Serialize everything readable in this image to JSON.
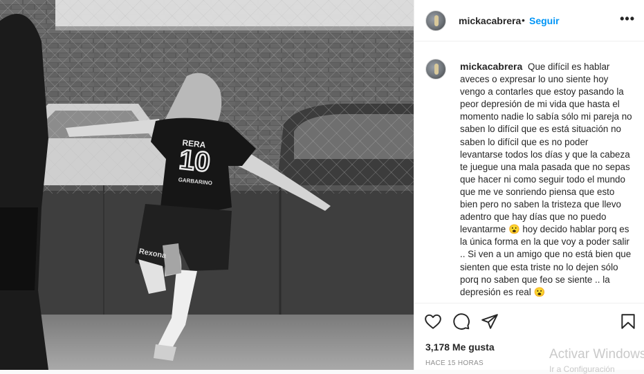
{
  "post": {
    "username": "mickacabrera",
    "separator": "•",
    "follow_label": "Seguir",
    "more_icon": "more-options-icon",
    "caption": "Que difícil es hablar aveces o expresar lo uno siente hoy vengo a contarles que estoy pasando la peor depresión de mi vida que hasta el momento nadie lo sabía sólo mi pareja no saben lo difícil que es está situación no saben lo difícil que es no poder levantarse todos los días y que la cabeza te juegue una mala pasada que no sepas que hacer ni como seguir todo el mundo que me ve sonriendo piensa que esto bien pero no saben la tristeza que llevo adentro que hay días que no puedo levantarme 😮 hoy decido hablar porq es la única forma en la que voy a poder salir .. Si ven a un amigo que no está bien que sienten que esta triste no lo dejen sólo porq no saben que feo se siente .. la depresión es real 😮",
    "likes": "3,178 Me gusta",
    "time": "HACE 15 HORAS",
    "jersey_name": "RERA",
    "jersey_number": "10",
    "jersey_sponsor": "GARBARINO",
    "shorts_brand": "Rexona"
  },
  "actions": {
    "like_icon": "heart-icon",
    "comment_icon": "comment-icon",
    "share_icon": "share-icon",
    "save_icon": "bookmark-icon"
  },
  "overlay": {
    "watermark": "Activar Windows",
    "watermark_sub": "Ir a Configuración"
  },
  "colors": {
    "accent": "#0095f6",
    "text": "#262626",
    "muted": "#8e8e8e"
  }
}
